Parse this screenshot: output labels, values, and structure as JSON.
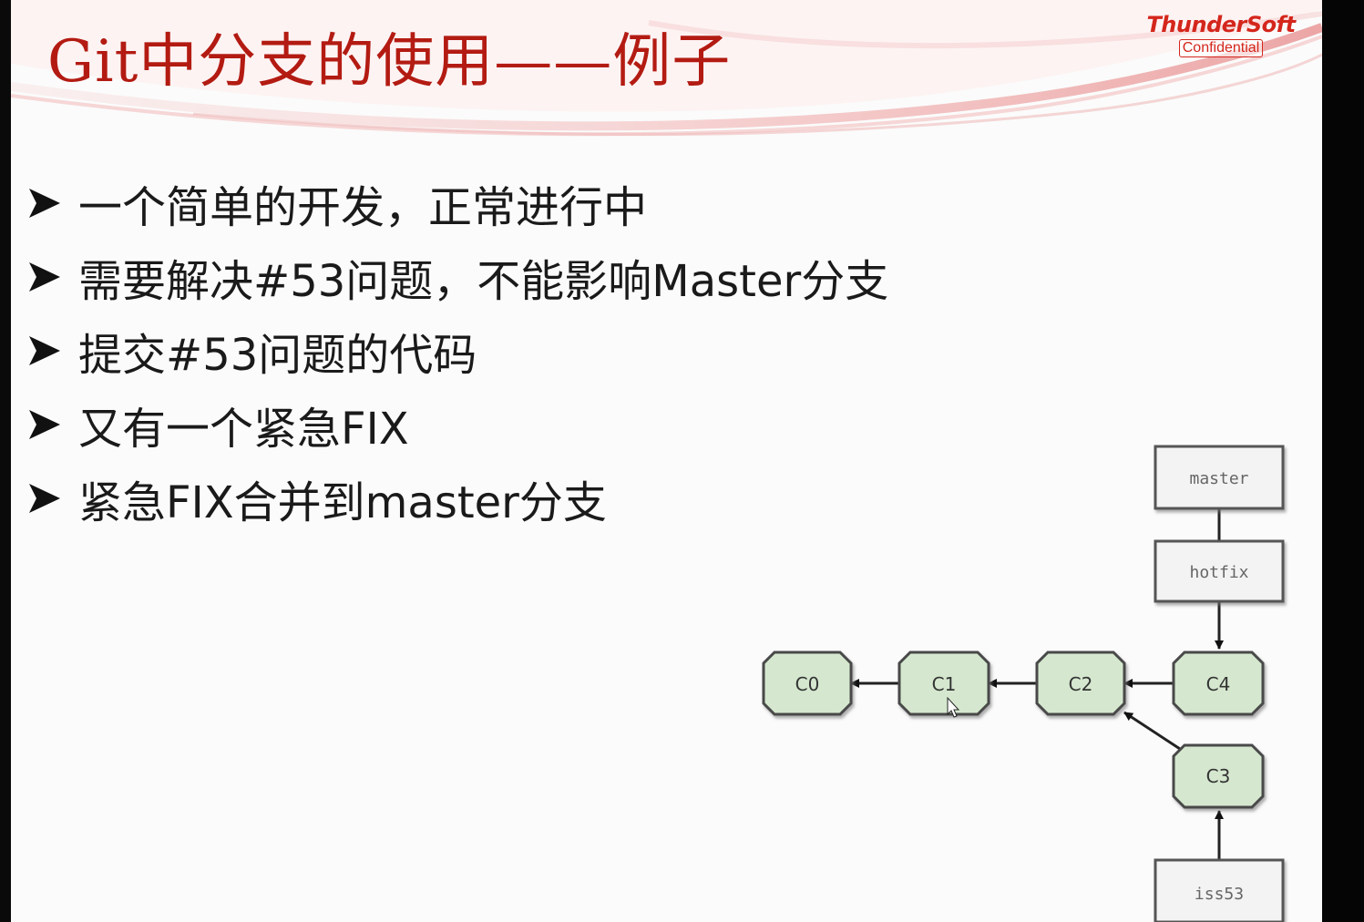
{
  "slide": {
    "title": "Git中分支的使用——例子",
    "logo": {
      "brand": "ThunderSoft",
      "badge": "Confidential"
    },
    "bullets": [
      "一个简单的开发，正常进行中",
      "需要解决#53问题，不能影响Master分支",
      "提交#53问题的代码",
      "又有一个紧急FIX",
      "紧急FIX合并到master分支"
    ]
  },
  "diagram": {
    "commits": [
      "C0",
      "C1",
      "C2",
      "C4",
      "C3"
    ],
    "branches": [
      "master",
      "hotfix",
      "iss53"
    ]
  },
  "colors": {
    "title": "#b31b12",
    "brand": "#d4261c",
    "commit_fill": "#d5e8cf",
    "commit_stroke": "#4a4a4a",
    "branch_fill": "#f2f2f2"
  }
}
